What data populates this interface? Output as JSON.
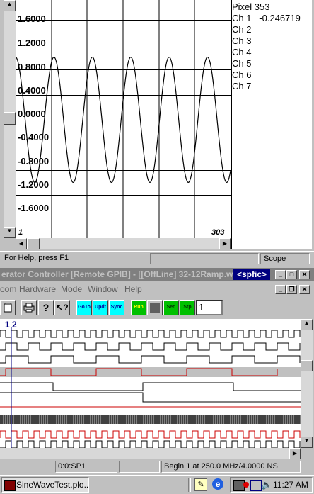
{
  "scope": {
    "y_labels": [
      "1.6000",
      "1.2000",
      "0.8000",
      "0.4000",
      "0.0000",
      "-0.4000",
      "-0.8000",
      "-1.2000",
      "-1.6000"
    ],
    "x_start": "1",
    "x_end": "303",
    "readout": {
      "pixel": "Pixel 353",
      "channels": [
        "Ch 1   -0.246719",
        "Ch 2",
        "Ch 3",
        "Ch 4",
        "Ch 5",
        "Ch 6",
        "Ch 7"
      ]
    },
    "status_help": "For Help, press F1",
    "status_mode": "Scope",
    "chart_data": {
      "type": "line",
      "ylim": [
        -1.9,
        1.9
      ],
      "series": [
        {
          "amplitude": 1.0,
          "cycles": 5.6
        }
      ]
    }
  },
  "generator": {
    "title": "erator Controller [Remote GPIB] - [[OffLine] 32-12Ramp.w",
    "badge": "<spfic>",
    "menu": [
      "oom",
      "Hardware",
      "Mode",
      "Window",
      "Help"
    ],
    "toolbar": {
      "goto": "GoTo",
      "updt": "Updt",
      "sync": "Sync",
      "run": "Run",
      "seq": "Seq",
      "stp": "Stp",
      "value": "1"
    },
    "cursor_label": "1 2",
    "status": [
      "0:0:SP1",
      "Begin 1 at 250.0 MHz/4.0000 NS"
    ]
  },
  "taskbar": {
    "app_label": "SineWaveTest.plo...",
    "clock": "11:27 AM"
  },
  "colors": {
    "title_active": "#000080",
    "title_inactive": "#808080",
    "trace_black": "#000000",
    "trace_red": "#cc0000",
    "toolbar_cyan": "#00ffff",
    "toolbar_green": "#00c000"
  }
}
